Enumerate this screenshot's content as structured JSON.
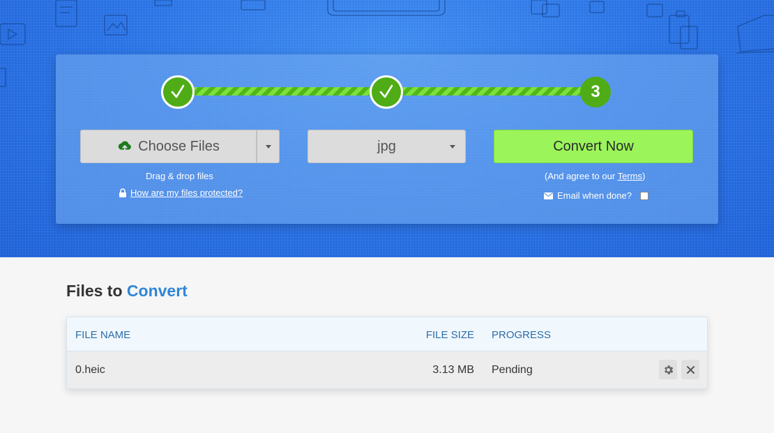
{
  "stepper": {
    "steps": [
      {
        "state": "done",
        "icon": "check-icon"
      },
      {
        "state": "done",
        "icon": "check-icon"
      },
      {
        "state": "current",
        "label": "3"
      }
    ],
    "colors": {
      "step": "#4fac16",
      "track_light": "#7fe03a",
      "track_dark": "#4fb71a"
    }
  },
  "upload": {
    "choose_label": "Choose Files",
    "choose_icon": "cloud-upload-icon",
    "drag_hint": "Drag & drop files",
    "protect_link": "How are my files protected?",
    "protect_icon": "lock-icon"
  },
  "format": {
    "selected": "jpg"
  },
  "convert": {
    "button_label": "Convert Now",
    "agree_prefix": "(And agree to our ",
    "agree_link": "Terms",
    "agree_suffix": ")",
    "email_label": "Email when done?",
    "email_icon": "envelope-icon",
    "email_checked": false,
    "button_color": "#9bf55a"
  },
  "files_section": {
    "title_prefix": "Files to ",
    "title_accent": "Convert",
    "accent_color": "#2f86d6",
    "columns": {
      "name": "FILE NAME",
      "size": "FILE SIZE",
      "progress": "PROGRESS"
    },
    "rows": [
      {
        "name": "0.heic",
        "size": "3.13 MB",
        "progress": "Pending"
      }
    ]
  }
}
